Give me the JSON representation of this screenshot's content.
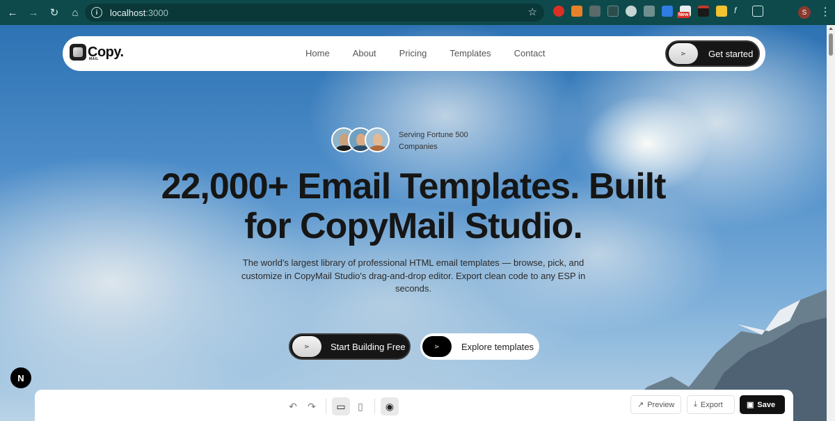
{
  "browser": {
    "url_host": "localhost",
    "url_port": ":3000",
    "new_badge": "New",
    "profile_initial": "S"
  },
  "site": {
    "logo": {
      "name": "Copy.",
      "sub": "MAIL"
    },
    "nav": [
      "Home",
      "About",
      "Pricing",
      "Templates",
      "Contact"
    ],
    "cta": "Get started"
  },
  "hero": {
    "serving_line1": "Serving Fortune 500",
    "serving_line2": "Companies",
    "headline_line1": "22,000+ Email Templates. Built",
    "headline_line2": "for CopyMail Studio.",
    "subtext": "The world's largest library of professional HTML email templates — browse, pick, and customize in CopyMail Studio's drag-and-drop editor. Export clean code to any ESP in seconds.",
    "primary_button": "Start Building Free",
    "secondary_button": "Explore templates"
  },
  "editor": {
    "preview": "Preview",
    "export": "Export",
    "save": "Save"
  },
  "next_badge": "N",
  "colors": {
    "browser_chrome": "#0e4a4b",
    "dark_button": "#161616",
    "text_dark": "#161616"
  }
}
